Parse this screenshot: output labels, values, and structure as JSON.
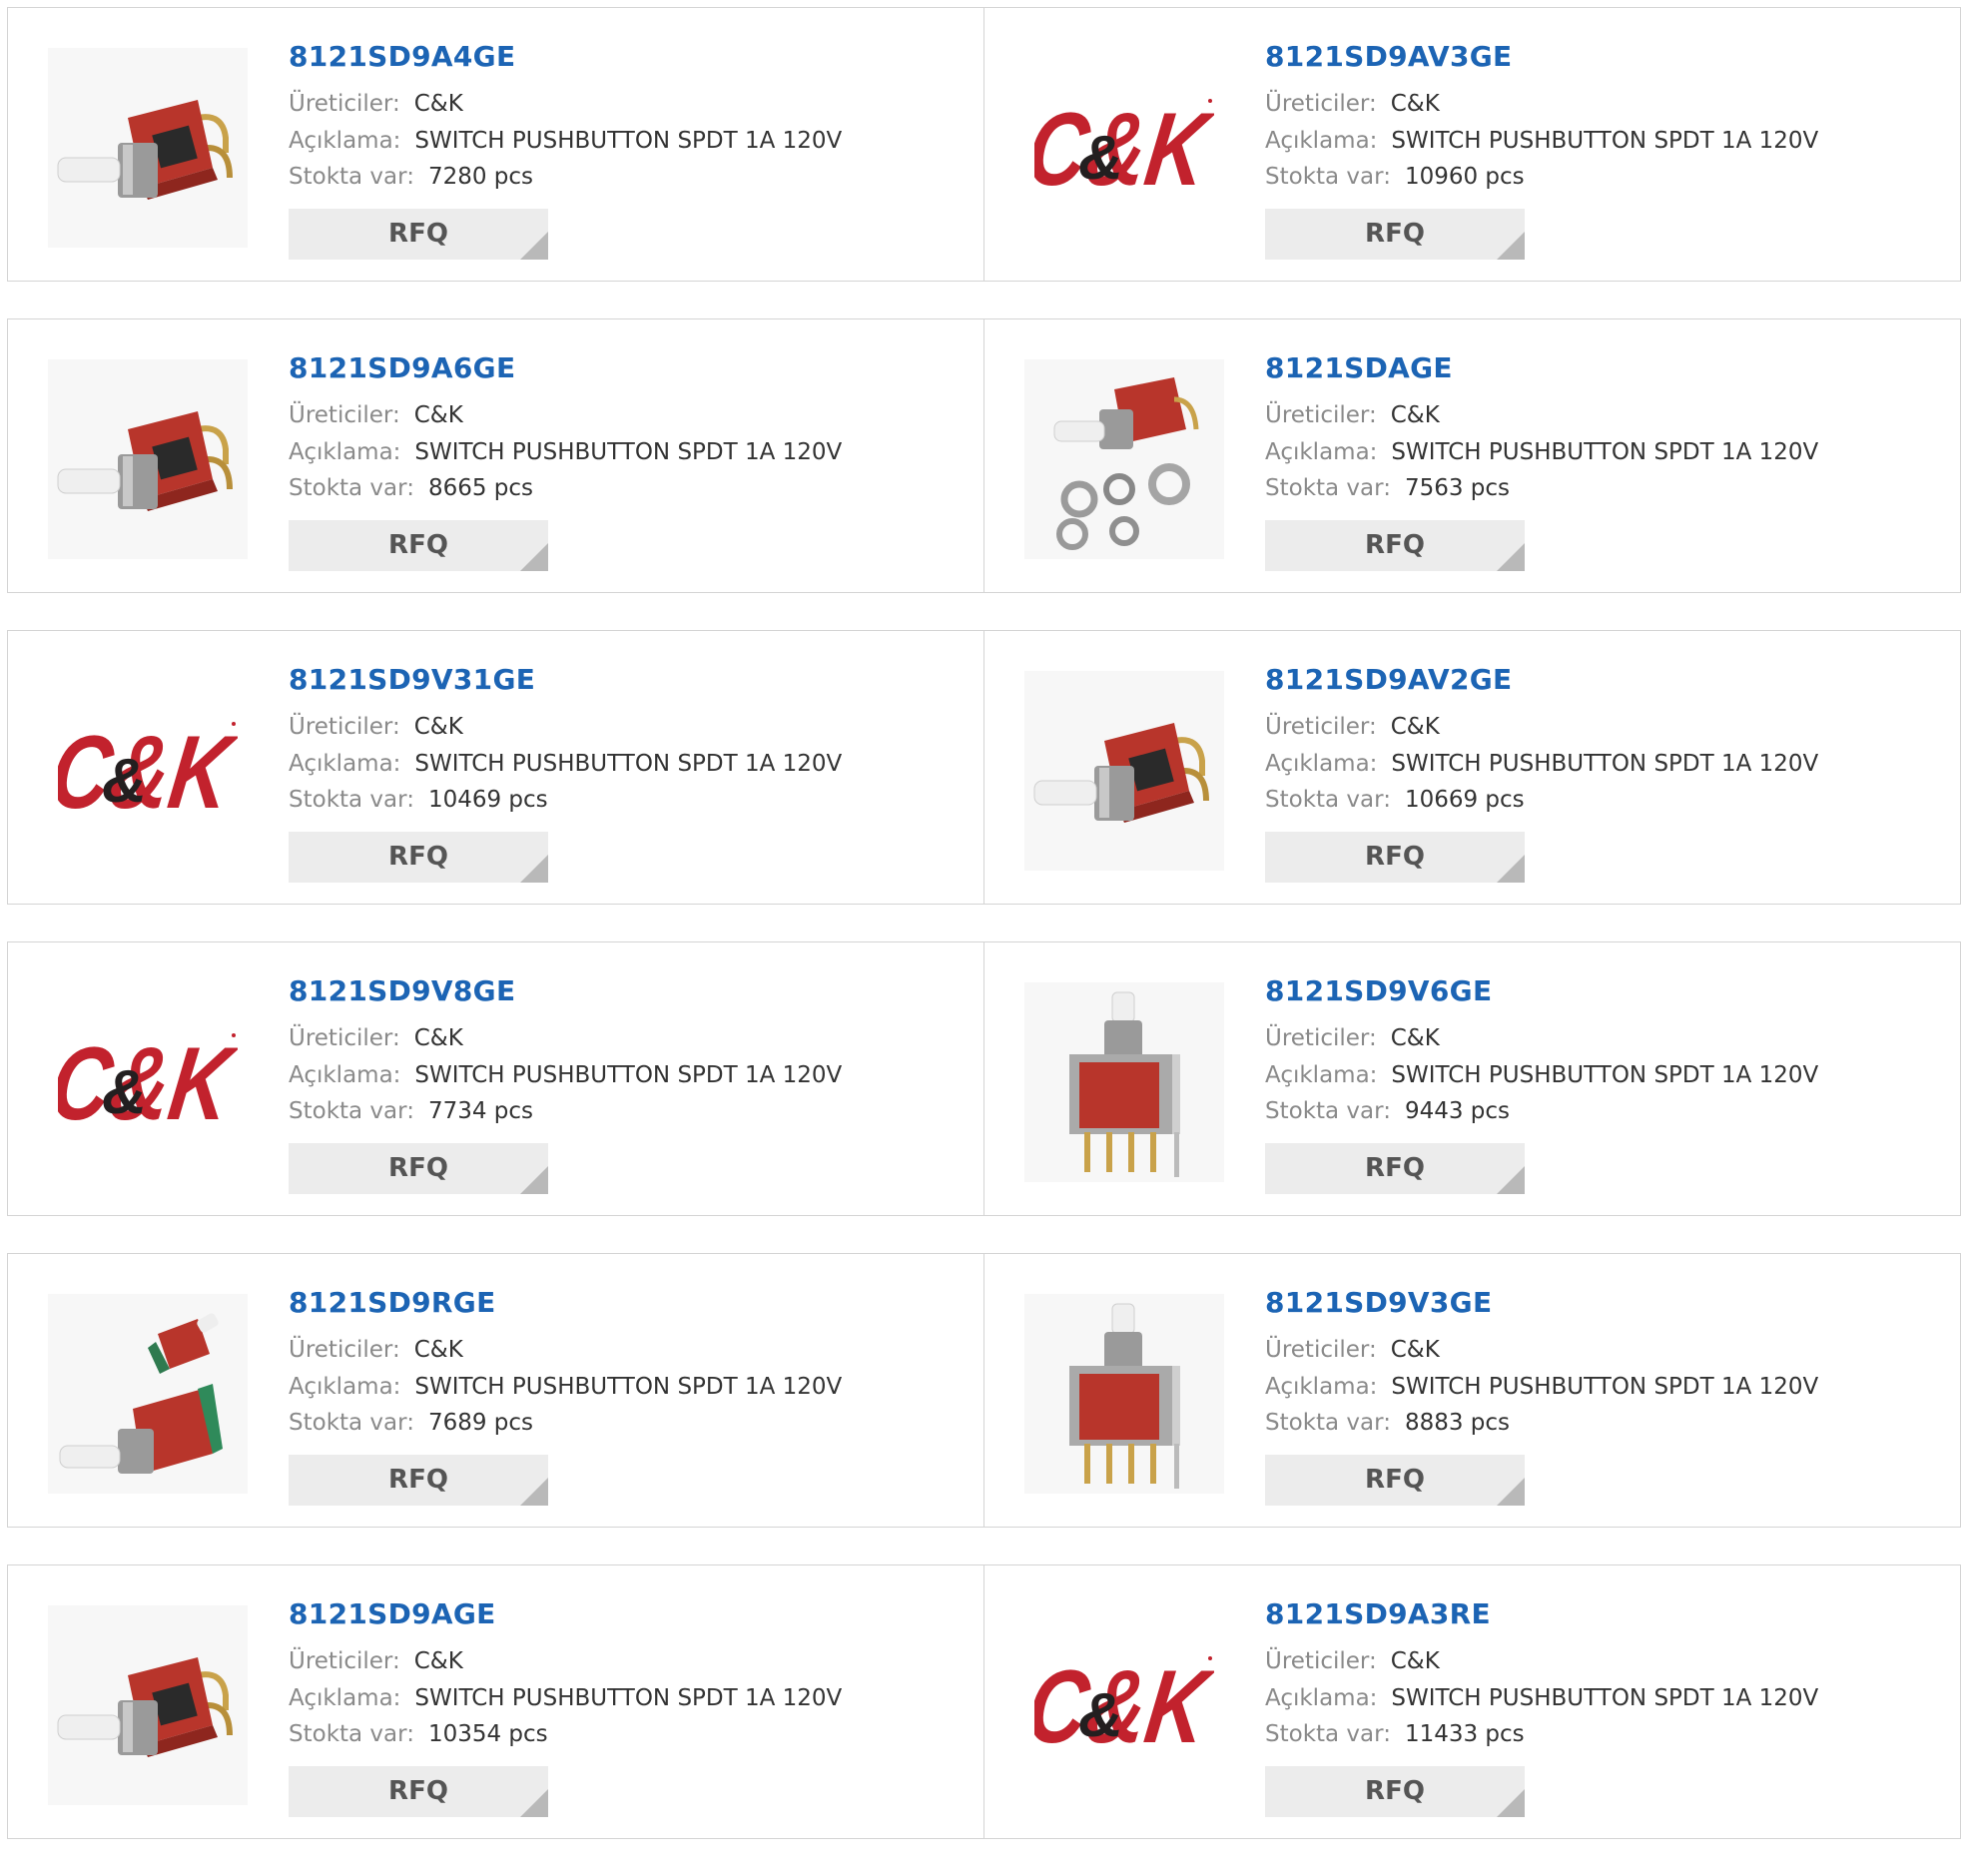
{
  "labels": {
    "manufacturer": "Üreticiler:",
    "description": "Açıklama:",
    "stock": "Stokta var:",
    "rfq": "RFQ"
  },
  "colors": {
    "title_blue": "#1c64b4",
    "logo_red": "#c2222d",
    "logo_black": "#231f20",
    "button_gray": "#ececec"
  },
  "products": [
    {
      "part": "8121SD9A4GE",
      "manufacturer": "C&K",
      "description": "SWITCH PUSHBUTTON SPDT 1A 120V",
      "stock": "7280 pcs",
      "image": "right-angle-switch"
    },
    {
      "part": "8121SD9AV3GE",
      "manufacturer": "C&K",
      "description": "SWITCH PUSHBUTTON SPDT 1A 120V",
      "stock": "10960 pcs",
      "image": "ck-logo"
    },
    {
      "part": "8121SD9A6GE",
      "manufacturer": "C&K",
      "description": "SWITCH PUSHBUTTON SPDT 1A 120V",
      "stock": "8665 pcs",
      "image": "right-angle-switch"
    },
    {
      "part": "8121SDAGE",
      "manufacturer": "C&K",
      "description": "SWITCH PUSHBUTTON SPDT 1A 120V",
      "stock": "7563 pcs",
      "image": "switch-with-nuts"
    },
    {
      "part": "8121SD9V31GE",
      "manufacturer": "C&K",
      "description": "SWITCH PUSHBUTTON SPDT 1A 120V",
      "stock": "10469 pcs",
      "image": "ck-logo"
    },
    {
      "part": "8121SD9AV2GE",
      "manufacturer": "C&K",
      "description": "SWITCH PUSHBUTTON SPDT 1A 120V",
      "stock": "10669 pcs",
      "image": "right-angle-switch"
    },
    {
      "part": "8121SD9V8GE",
      "manufacturer": "C&K",
      "description": "SWITCH PUSHBUTTON SPDT 1A 120V",
      "stock": "7734 pcs",
      "image": "ck-logo"
    },
    {
      "part": "8121SD9V6GE",
      "manufacturer": "C&K",
      "description": "SWITCH PUSHBUTTON SPDT 1A 120V",
      "stock": "9443 pcs",
      "image": "vertical-switch"
    },
    {
      "part": "8121SD9RGE",
      "manufacturer": "C&K",
      "description": "SWITCH PUSHBUTTON SPDT 1A 120V",
      "stock": "7689 pcs",
      "image": "two-switches"
    },
    {
      "part": "8121SD9V3GE",
      "manufacturer": "C&K",
      "description": "SWITCH PUSHBUTTON SPDT 1A 120V",
      "stock": "8883 pcs",
      "image": "vertical-switch"
    },
    {
      "part": "8121SD9AGE",
      "manufacturer": "C&K",
      "description": "SWITCH PUSHBUTTON SPDT 1A 120V",
      "stock": "10354 pcs",
      "image": "right-angle-switch"
    },
    {
      "part": "8121SD9A3RE",
      "manufacturer": "C&K",
      "description": "SWITCH PUSHBUTTON SPDT 1A 120V",
      "stock": "11433 pcs",
      "image": "ck-logo"
    }
  ]
}
